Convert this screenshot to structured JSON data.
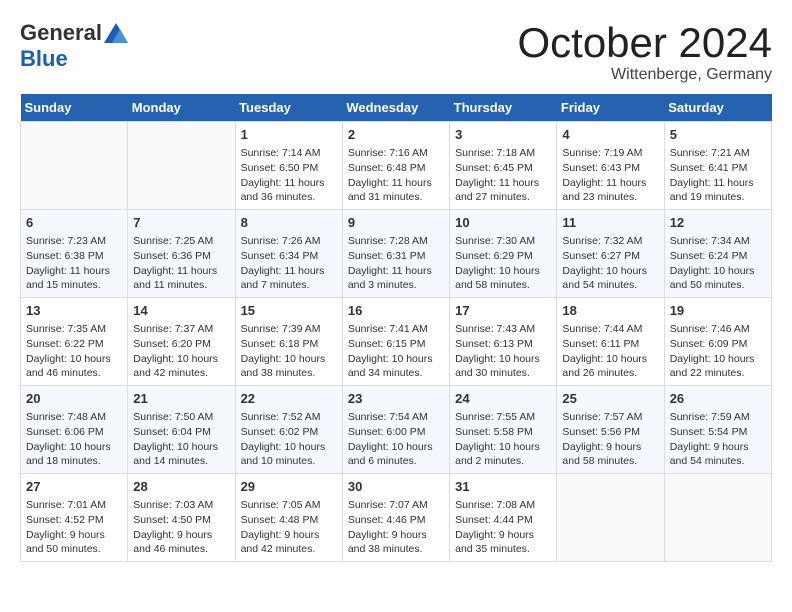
{
  "header": {
    "logo_general": "General",
    "logo_blue": "Blue",
    "title": "October 2024",
    "location": "Wittenberge, Germany"
  },
  "days_of_week": [
    "Sunday",
    "Monday",
    "Tuesday",
    "Wednesday",
    "Thursday",
    "Friday",
    "Saturday"
  ],
  "weeks": [
    [
      {
        "day": "",
        "content": ""
      },
      {
        "day": "",
        "content": ""
      },
      {
        "day": "1",
        "content": "Sunrise: 7:14 AM\nSunset: 6:50 PM\nDaylight: 11 hours and 36 minutes."
      },
      {
        "day": "2",
        "content": "Sunrise: 7:16 AM\nSunset: 6:48 PM\nDaylight: 11 hours and 31 minutes."
      },
      {
        "day": "3",
        "content": "Sunrise: 7:18 AM\nSunset: 6:45 PM\nDaylight: 11 hours and 27 minutes."
      },
      {
        "day": "4",
        "content": "Sunrise: 7:19 AM\nSunset: 6:43 PM\nDaylight: 11 hours and 23 minutes."
      },
      {
        "day": "5",
        "content": "Sunrise: 7:21 AM\nSunset: 6:41 PM\nDaylight: 11 hours and 19 minutes."
      }
    ],
    [
      {
        "day": "6",
        "content": "Sunrise: 7:23 AM\nSunset: 6:38 PM\nDaylight: 11 hours and 15 minutes."
      },
      {
        "day": "7",
        "content": "Sunrise: 7:25 AM\nSunset: 6:36 PM\nDaylight: 11 hours and 11 minutes."
      },
      {
        "day": "8",
        "content": "Sunrise: 7:26 AM\nSunset: 6:34 PM\nDaylight: 11 hours and 7 minutes."
      },
      {
        "day": "9",
        "content": "Sunrise: 7:28 AM\nSunset: 6:31 PM\nDaylight: 11 hours and 3 minutes."
      },
      {
        "day": "10",
        "content": "Sunrise: 7:30 AM\nSunset: 6:29 PM\nDaylight: 10 hours and 58 minutes."
      },
      {
        "day": "11",
        "content": "Sunrise: 7:32 AM\nSunset: 6:27 PM\nDaylight: 10 hours and 54 minutes."
      },
      {
        "day": "12",
        "content": "Sunrise: 7:34 AM\nSunset: 6:24 PM\nDaylight: 10 hours and 50 minutes."
      }
    ],
    [
      {
        "day": "13",
        "content": "Sunrise: 7:35 AM\nSunset: 6:22 PM\nDaylight: 10 hours and 46 minutes."
      },
      {
        "day": "14",
        "content": "Sunrise: 7:37 AM\nSunset: 6:20 PM\nDaylight: 10 hours and 42 minutes."
      },
      {
        "day": "15",
        "content": "Sunrise: 7:39 AM\nSunset: 6:18 PM\nDaylight: 10 hours and 38 minutes."
      },
      {
        "day": "16",
        "content": "Sunrise: 7:41 AM\nSunset: 6:15 PM\nDaylight: 10 hours and 34 minutes."
      },
      {
        "day": "17",
        "content": "Sunrise: 7:43 AM\nSunset: 6:13 PM\nDaylight: 10 hours and 30 minutes."
      },
      {
        "day": "18",
        "content": "Sunrise: 7:44 AM\nSunset: 6:11 PM\nDaylight: 10 hours and 26 minutes."
      },
      {
        "day": "19",
        "content": "Sunrise: 7:46 AM\nSunset: 6:09 PM\nDaylight: 10 hours and 22 minutes."
      }
    ],
    [
      {
        "day": "20",
        "content": "Sunrise: 7:48 AM\nSunset: 6:06 PM\nDaylight: 10 hours and 18 minutes."
      },
      {
        "day": "21",
        "content": "Sunrise: 7:50 AM\nSunset: 6:04 PM\nDaylight: 10 hours and 14 minutes."
      },
      {
        "day": "22",
        "content": "Sunrise: 7:52 AM\nSunset: 6:02 PM\nDaylight: 10 hours and 10 minutes."
      },
      {
        "day": "23",
        "content": "Sunrise: 7:54 AM\nSunset: 6:00 PM\nDaylight: 10 hours and 6 minutes."
      },
      {
        "day": "24",
        "content": "Sunrise: 7:55 AM\nSunset: 5:58 PM\nDaylight: 10 hours and 2 minutes."
      },
      {
        "day": "25",
        "content": "Sunrise: 7:57 AM\nSunset: 5:56 PM\nDaylight: 9 hours and 58 minutes."
      },
      {
        "day": "26",
        "content": "Sunrise: 7:59 AM\nSunset: 5:54 PM\nDaylight: 9 hours and 54 minutes."
      }
    ],
    [
      {
        "day": "27",
        "content": "Sunrise: 7:01 AM\nSunset: 4:52 PM\nDaylight: 9 hours and 50 minutes."
      },
      {
        "day": "28",
        "content": "Sunrise: 7:03 AM\nSunset: 4:50 PM\nDaylight: 9 hours and 46 minutes."
      },
      {
        "day": "29",
        "content": "Sunrise: 7:05 AM\nSunset: 4:48 PM\nDaylight: 9 hours and 42 minutes."
      },
      {
        "day": "30",
        "content": "Sunrise: 7:07 AM\nSunset: 4:46 PM\nDaylight: 9 hours and 38 minutes."
      },
      {
        "day": "31",
        "content": "Sunrise: 7:08 AM\nSunset: 4:44 PM\nDaylight: 9 hours and 35 minutes."
      },
      {
        "day": "",
        "content": ""
      },
      {
        "day": "",
        "content": ""
      }
    ]
  ]
}
